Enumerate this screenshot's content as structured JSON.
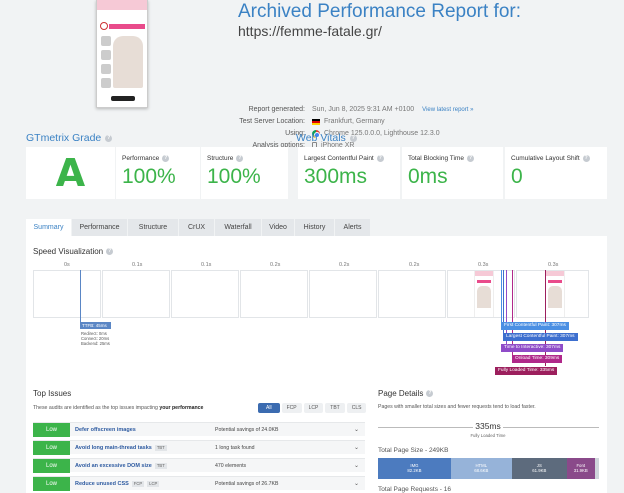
{
  "header": {
    "title": "Archived Performance Report for:",
    "url": "https://femme-fatale.gr/",
    "meta": [
      {
        "key": "Report generated:",
        "value": "Sun, Jun 8, 2025 9:31 AM +0100",
        "link": "View latest report »",
        "icon": ""
      },
      {
        "key": "Test Server Location:",
        "value": "Frankfurt, Germany",
        "link": "",
        "icon": "germany-flag-icon"
      },
      {
        "key": "Using:",
        "value": "Chrome 125.0.0.0, Lighthouse 12.3.0",
        "link": "",
        "icon": "chrome-icon"
      },
      {
        "key": "Analysis options:",
        "value": "iPhone XR",
        "link": "",
        "icon": "phone-icon"
      }
    ]
  },
  "grade": {
    "title": "GTmetrix Grade",
    "letter": "A",
    "performance_label": "Performance",
    "performance_value": "100%",
    "structure_label": "Structure",
    "structure_value": "100%"
  },
  "vitals": {
    "title": "Web Vitals",
    "lcp_label": "Largest Contentful Paint",
    "lcp_value": "300ms",
    "tbt_label": "Total Blocking Time",
    "tbt_value": "0ms",
    "cls_label": "Cumulative Layout Shift",
    "cls_value": "0"
  },
  "tabs": [
    "Summary",
    "Performance",
    "Structure",
    "CrUX",
    "Waterfall",
    "Video",
    "History",
    "Alerts"
  ],
  "speed_viz": {
    "title": "Speed Visualization",
    "ticks": [
      "0s",
      "0.1s",
      "0.1s",
      "0.2s",
      "0.2s",
      "0.2s",
      "0.3s",
      "0.3s"
    ],
    "ttfb_label": "TTFB: 45ms",
    "ttfb_details": [
      "Redirect: 0ms",
      "Connect: 20ms",
      "Backend: 25ms"
    ],
    "milestones": [
      {
        "label": "First Contentful Paint: 307ms",
        "color": "#4a8fe3"
      },
      {
        "label": "Largest Contentful Paint: 307ms",
        "color": "#3d6fcf"
      },
      {
        "label": "Time to Interactive: 307ms",
        "color": "#8f4cc8"
      },
      {
        "label": "Onload Time: 309ms",
        "color": "#b0288a"
      },
      {
        "label": "Fully Loaded Time: 335ms",
        "color": "#9c1f5d"
      }
    ]
  },
  "top_issues": {
    "title": "Top Issues",
    "desc_prefix": "These audits are identified as the top issues impacting",
    "desc_bold": "your performance",
    "filters": [
      "All",
      "FCP",
      "LCP",
      "TBT",
      "CLS"
    ],
    "rows": [
      {
        "impact": "Low",
        "name": "Defer offscreen images",
        "tags": [],
        "detail": "Potential savings of 24.0KB"
      },
      {
        "impact": "Low",
        "name": "Avoid long main-thread tasks",
        "tags": [
          "TBT"
        ],
        "detail": "1 long task found"
      },
      {
        "impact": "Low",
        "name": "Avoid an excessive DOM size",
        "tags": [
          "TBT"
        ],
        "detail": "470 elements"
      },
      {
        "impact": "Low",
        "name": "Reduce unused CSS",
        "tags": [
          "FCP",
          "LCP"
        ],
        "detail": "Potential savings of 26.7KB"
      }
    ]
  },
  "page_details": {
    "title": "Page Details",
    "desc": "Pages with smaller total sizes and fewer requests tend to load faster.",
    "fully_loaded_value": "335ms",
    "fully_loaded_label": "Fully Loaded Time",
    "total_size_title": "Total Page Size - 249KB",
    "segments": [
      {
        "label": "IMG",
        "size": "82.2KB",
        "fraction": 0.33,
        "color": "#4c7bbf"
      },
      {
        "label": "HTML",
        "size": "68.6KB",
        "fraction": 0.275,
        "color": "#96b3d9"
      },
      {
        "label": "JS",
        "size": "61.9KB",
        "fraction": 0.25,
        "color": "#5d6b7d"
      },
      {
        "label": "Font",
        "size": "31.9KB",
        "fraction": 0.125,
        "color": "#8a4a8a"
      },
      {
        "label": "",
        "size": "",
        "fraction": 0.02,
        "color": "#cfd5db"
      }
    ],
    "total_requests_title": "Total Page Requests - 16"
  }
}
